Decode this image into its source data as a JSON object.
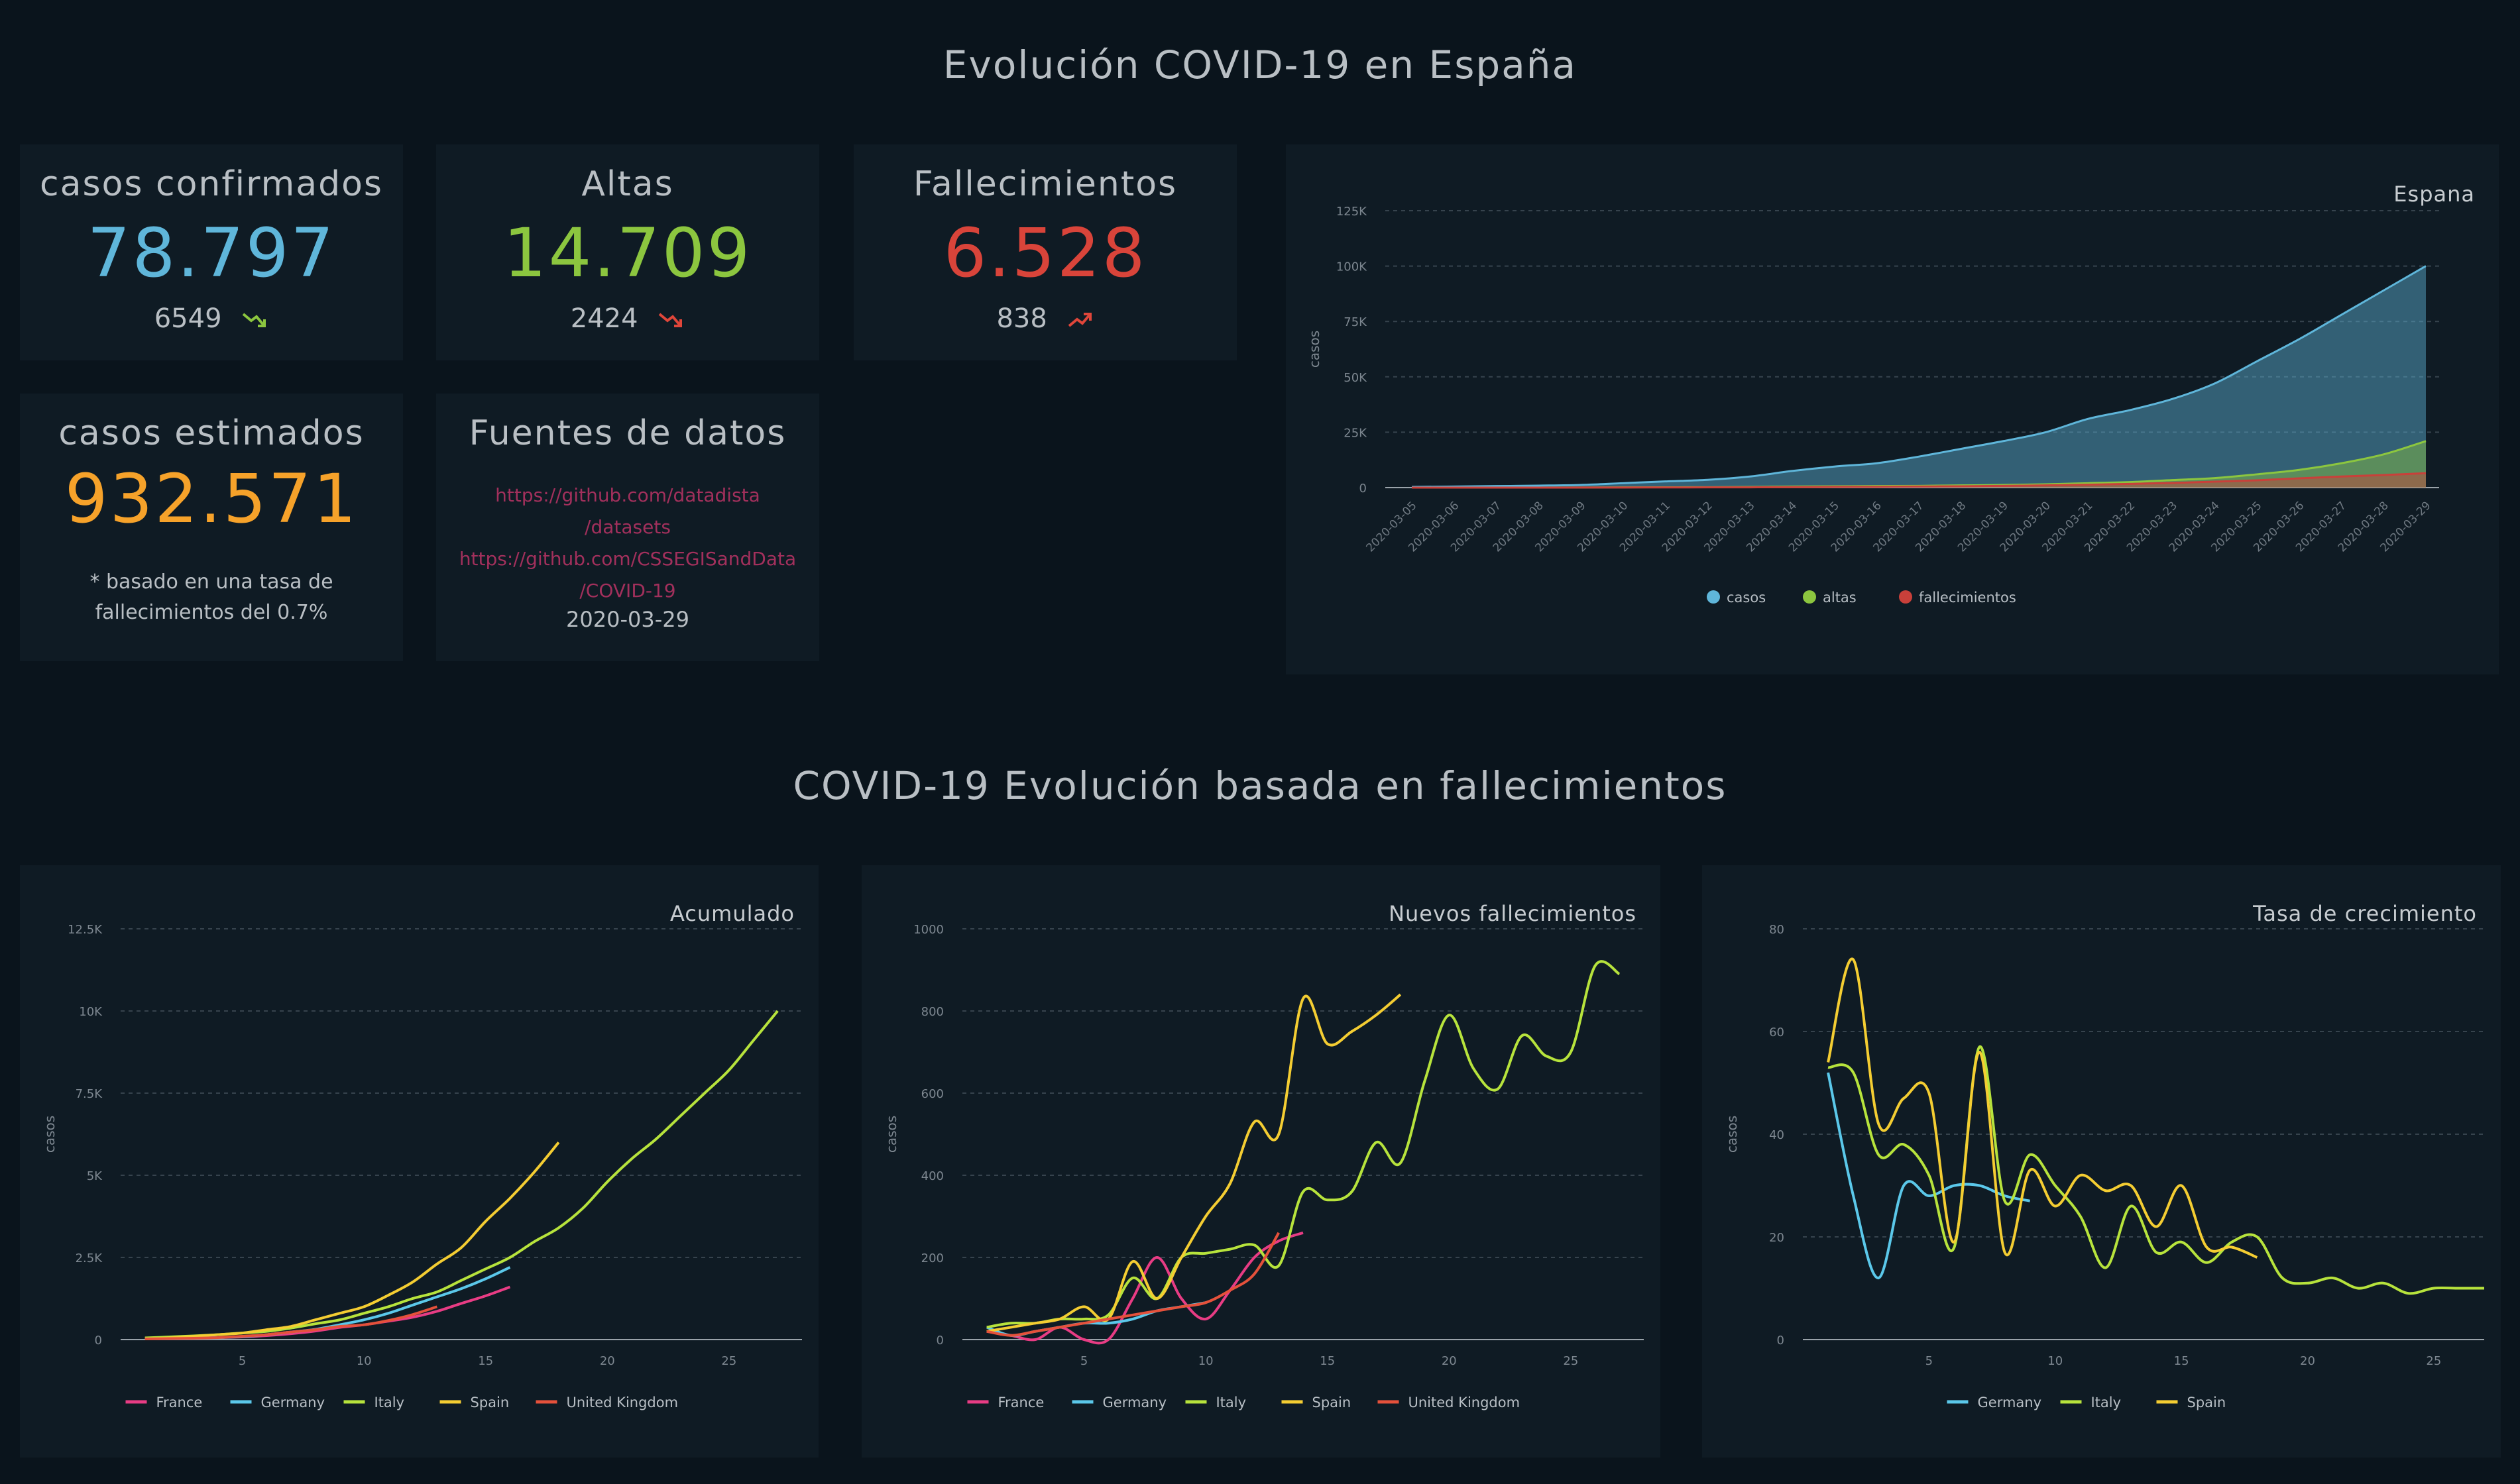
{
  "page": {
    "title": "Evolución COVID-19 en España",
    "section_title": "COVID-19 Evolución basada en fallecimientos"
  },
  "cards": {
    "confirmed": {
      "label": "casos confirmados",
      "value": "78.797",
      "delta": "6549",
      "trend": "down",
      "color": "#5fb6da",
      "trend_color": "#8cc63f"
    },
    "recovered": {
      "label": "Altas",
      "value": "14.709",
      "delta": "2424",
      "trend": "down",
      "color": "#8cc63f",
      "trend_color": "#e0463a"
    },
    "deaths": {
      "label": "Fallecimientos",
      "value": "6.528",
      "delta": "838",
      "trend": "up",
      "color": "#d9443a",
      "trend_color": "#e0463a"
    },
    "estimated": {
      "label": "casos estimados",
      "value": "932.571",
      "note_line1": "* basado en una tasa de",
      "note_line2": "fallecimientos del 0.7%",
      "color": "#f6a22a"
    },
    "sources": {
      "label": "Fuentes de datos",
      "link1_line1": "https://github.com/datadista",
      "link1_line2": "/datasets",
      "link2_line1": "https://github.com/CSSEGISandData",
      "link2_line2": "/COVID-19",
      "date": "2020-03-29",
      "link_color": "#a2305c"
    }
  },
  "colors": {
    "casos": "#5fb6da",
    "altas": "#8cc63f",
    "fallecimientos": "#c9403a",
    "France": "#e83c84",
    "Germany": "#5bc8ea",
    "Italy": "#b7e33c",
    "Spain": "#f4cd32",
    "United Kingdom": "#e5513b"
  },
  "chart_data": [
    {
      "id": "spain",
      "type": "area",
      "title": "Espana",
      "ylabel": "casos",
      "ylim": [
        0,
        125000
      ],
      "yticks": [
        0,
        25000,
        50000,
        75000,
        100000,
        125000
      ],
      "ytick_labels": [
        "0",
        "25K",
        "50K",
        "75K",
        "100K",
        "125K"
      ],
      "categories": [
        "2020-03-05",
        "2020-03-06",
        "2020-03-07",
        "2020-03-08",
        "2020-03-09",
        "2020-03-10",
        "2020-03-11",
        "2020-03-12",
        "2020-03-13",
        "2020-03-14",
        "2020-03-15",
        "2020-03-16",
        "2020-03-17",
        "2020-03-18",
        "2020-03-19",
        "2020-03-20",
        "2020-03-21",
        "2020-03-22",
        "2020-03-23",
        "2020-03-24",
        "2020-03-25",
        "2020-03-26",
        "2020-03-27",
        "2020-03-28",
        "2020-03-29"
      ],
      "series": [
        {
          "name": "casos",
          "values": [
            300,
            500,
            700,
            900,
            1200,
            2000,
            2800,
            3500,
            5000,
            7500,
            9500,
            11000,
            14000,
            17500,
            21000,
            25000,
            31000,
            35000,
            40000,
            47000,
            57000,
            67000,
            78000,
            89000,
            100000
          ]
        },
        {
          "name": "altas",
          "values": [
            0,
            0,
            0,
            0,
            50,
            100,
            150,
            200,
            300,
            500,
            600,
            700,
            800,
            1000,
            1200,
            1500,
            2000,
            2500,
            3400,
            4300,
            6000,
            8000,
            11000,
            15000,
            21000
          ]
        },
        {
          "name": "fallecimientos",
          "values": [
            0,
            0,
            0,
            0,
            20,
            40,
            80,
            100,
            130,
            180,
            300,
            350,
            500,
            600,
            800,
            1000,
            1300,
            1700,
            2100,
            2700,
            3300,
            4200,
            5000,
            5700,
            6500
          ]
        }
      ],
      "legend": "bottom",
      "grid": true
    },
    {
      "id": "acumulado",
      "type": "line",
      "title": "Acumulado",
      "ylabel": "casos",
      "ylim": [
        0,
        12500
      ],
      "xlim": [
        0,
        28
      ],
      "xticks": [
        5,
        10,
        15,
        20,
        25
      ],
      "yticks": [
        0,
        2500,
        5000,
        7500,
        10000,
        12500
      ],
      "ytick_labels": [
        "0",
        "2.5K",
        "5K",
        "7.5K",
        "10K",
        "12.5K"
      ],
      "series": [
        {
          "name": "France",
          "x": [
            1,
            2,
            3,
            4,
            5,
            6,
            7,
            8,
            9,
            10,
            11,
            12,
            13,
            14,
            15,
            16
          ],
          "y": [
            30,
            40,
            50,
            60,
            80,
            120,
            180,
            260,
            370,
            450,
            560,
            680,
            860,
            1100,
            1330,
            1600
          ]
        },
        {
          "name": "Germany",
          "x": [
            1,
            2,
            3,
            4,
            5,
            6,
            7,
            8,
            9,
            10,
            11,
            12,
            13,
            14,
            15,
            16
          ],
          "y": [
            20,
            30,
            40,
            60,
            90,
            150,
            230,
            310,
            450,
            600,
            800,
            1050,
            1300,
            1550,
            1850,
            2200
          ]
        },
        {
          "name": "Italy",
          "x": [
            1,
            2,
            3,
            4,
            5,
            6,
            7,
            8,
            9,
            10,
            11,
            12,
            13,
            14,
            15,
            16,
            17,
            18,
            19,
            20,
            21,
            22,
            23,
            24,
            25,
            26,
            27
          ],
          "y": [
            50,
            80,
            110,
            150,
            200,
            250,
            350,
            480,
            600,
            800,
            1000,
            1250,
            1450,
            1800,
            2150,
            2500,
            2980,
            3400,
            4000,
            4800,
            5500,
            6100,
            6800,
            7500,
            8200,
            9100,
            10000
          ]
        },
        {
          "name": "Spain",
          "x": [
            1,
            2,
            3,
            4,
            5,
            6,
            7,
            8,
            9,
            10,
            11,
            12,
            13,
            14,
            15,
            16,
            17,
            18
          ],
          "y": [
            20,
            50,
            100,
            150,
            200,
            300,
            400,
            600,
            800,
            1000,
            1350,
            1750,
            2300,
            2800,
            3600,
            4300,
            5100,
            6000
          ]
        },
        {
          "name": "United Kingdom",
          "x": [
            1,
            2,
            3,
            4,
            5,
            6,
            7,
            8,
            9,
            10,
            11,
            12,
            13
          ],
          "y": [
            20,
            30,
            40,
            60,
            100,
            150,
            230,
            300,
            400,
            450,
            580,
            760,
            1000
          ]
        }
      ],
      "legend": "bottom",
      "grid": true
    },
    {
      "id": "nuevos",
      "type": "line",
      "title": "Nuevos fallecimientos",
      "ylabel": "casos",
      "ylim": [
        0,
        1000
      ],
      "xlim": [
        0,
        28
      ],
      "xticks": [
        5,
        10,
        15,
        20,
        25
      ],
      "yticks": [
        0,
        200,
        400,
        600,
        800,
        1000
      ],
      "ytick_labels": [
        "0",
        "200",
        "400",
        "600",
        "800",
        "1000"
      ],
      "series": [
        {
          "name": "France",
          "x": [
            1,
            2,
            3,
            4,
            5,
            6,
            7,
            8,
            9,
            10,
            11,
            12,
            13,
            14
          ],
          "y": [
            20,
            10,
            0,
            30,
            0,
            0,
            100,
            200,
            100,
            50,
            120,
            200,
            240,
            260
          ]
        },
        {
          "name": "Germany",
          "x": [
            1,
            2,
            3,
            4,
            5,
            6,
            7,
            8,
            9,
            10
          ],
          "y": [
            30,
            10,
            20,
            30,
            40,
            40,
            50,
            70,
            80,
            90
          ]
        },
        {
          "name": "Italy",
          "x": [
            1,
            2,
            3,
            4,
            5,
            6,
            7,
            8,
            9,
            10,
            11,
            12,
            13,
            14,
            15,
            16,
            17,
            18,
            19,
            20,
            21,
            22,
            23,
            24,
            25,
            26,
            27
          ],
          "y": [
            30,
            40,
            40,
            50,
            50,
            60,
            150,
            100,
            200,
            210,
            220,
            230,
            180,
            360,
            340,
            360,
            480,
            430,
            630,
            790,
            660,
            610,
            740,
            690,
            700,
            910,
            890
          ]
        },
        {
          "name": "Spain",
          "x": [
            1,
            2,
            3,
            4,
            5,
            6,
            7,
            8,
            9,
            10,
            11,
            12,
            13,
            14,
            15,
            16,
            17,
            18
          ],
          "y": [
            20,
            30,
            40,
            50,
            80,
            50,
            190,
            100,
            200,
            300,
            380,
            530,
            500,
            830,
            720,
            750,
            790,
            840
          ]
        },
        {
          "name": "United Kingdom",
          "x": [
            1,
            2,
            3,
            4,
            5,
            6,
            7,
            8,
            9,
            10,
            11,
            12,
            13
          ],
          "y": [
            20,
            10,
            20,
            30,
            40,
            50,
            60,
            70,
            80,
            90,
            120,
            160,
            260
          ]
        }
      ],
      "legend": "bottom",
      "grid": true
    },
    {
      "id": "tasa",
      "type": "line",
      "title": "Tasa de crecimiento",
      "ylabel": "casos",
      "ylim": [
        0,
        80
      ],
      "xlim": [
        0,
        27
      ],
      "xticks": [
        5,
        10,
        15,
        20,
        25
      ],
      "yticks": [
        0,
        20,
        40,
        60,
        80
      ],
      "ytick_labels": [
        "0",
        "20",
        "40",
        "60",
        "80"
      ],
      "series": [
        {
          "name": "Germany",
          "x": [
            1,
            2,
            3,
            4,
            5,
            6,
            7,
            8,
            9
          ],
          "y": [
            52,
            28,
            12,
            30,
            28,
            30,
            30,
            28,
            27
          ]
        },
        {
          "name": "Italy",
          "x": [
            1,
            2,
            3,
            4,
            5,
            6,
            7,
            8,
            9,
            10,
            11,
            12,
            13,
            14,
            15,
            16,
            17,
            18,
            19,
            20,
            21,
            22,
            23,
            24,
            25,
            26,
            27
          ],
          "y": [
            53,
            52,
            36,
            38,
            32,
            18,
            57,
            27,
            36,
            30,
            24,
            14,
            26,
            17,
            19,
            15,
            19,
            20,
            12,
            11,
            12,
            10,
            11,
            9,
            10,
            10,
            10
          ]
        },
        {
          "name": "Spain",
          "x": [
            1,
            2,
            3,
            4,
            5,
            6,
            7,
            8,
            9,
            10,
            11,
            12,
            13,
            14,
            15,
            16,
            17,
            18
          ],
          "y": [
            54,
            74,
            42,
            47,
            48,
            19,
            56,
            17,
            33,
            26,
            32,
            29,
            30,
            22,
            30,
            18,
            18,
            16
          ]
        }
      ],
      "legend": "bottom",
      "grid": true
    }
  ]
}
